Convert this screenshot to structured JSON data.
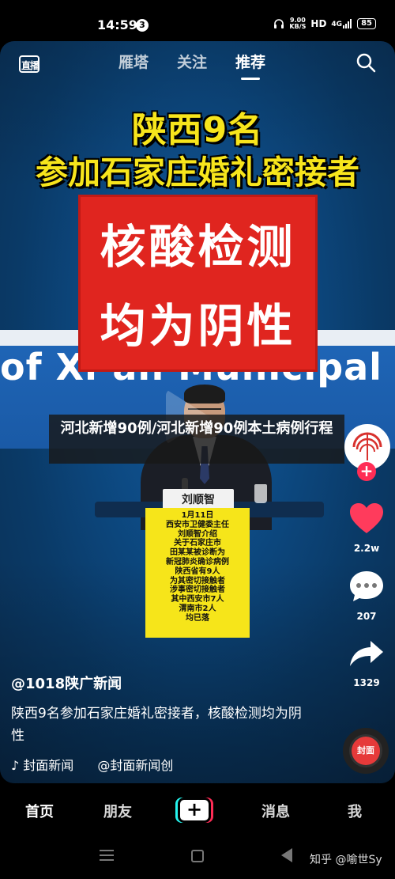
{
  "status": {
    "time": "14:59",
    "notification_count": "3",
    "speed_value": "9.00",
    "speed_unit": "KB/S",
    "hd": "HD",
    "signal": "4G",
    "battery": "85"
  },
  "nav": {
    "live_label": "直播",
    "tabs": [
      {
        "label": "雁塔"
      },
      {
        "label": "关注"
      },
      {
        "label": "推荐"
      }
    ],
    "active_tab": "推荐"
  },
  "video": {
    "headline_line1": "陕西9名",
    "headline_line2": "参加石家庄婚礼密接者",
    "red_line1": "核酸检测",
    "red_line2": "均为阴性",
    "backdrop_text": "of Xi’an Municipal P",
    "nameplate": "刘顺智",
    "info_card": [
      "1月11日",
      "西安市卫健委主任",
      "刘顺智介绍",
      "关于石家庄市",
      "田某某被诊断为",
      "新冠肺炎确诊病例",
      "陕西省有9人",
      "为其密切接触者",
      "涉事密切接触者",
      "其中西安市7人",
      "渭南市2人",
      "均已落"
    ]
  },
  "overlay_keyword": "河北新增90例/河北新增90例本土病例行程",
  "actions": {
    "like_count": "2.2w",
    "comment_count": "207",
    "share_count": "1329",
    "follow_plus": "+"
  },
  "post": {
    "author": "@1018陕广新闻",
    "caption": "陕西9名参加石家庄婚礼密接者，核酸检测均为阴性",
    "music_left": "♪ 封面新闻",
    "music_right": "@封面新闻创",
    "disc_label": "封面"
  },
  "tabbar": {
    "home": "首页",
    "friends": "朋友",
    "create": "+",
    "messages": "消息",
    "me": "我"
  },
  "watermark": "知乎 @喻世Sy",
  "colors": {
    "headline_yellow": "#f7e51c",
    "red_box": "#e0251f",
    "like_red": "#ff3b5c",
    "backdrop_blue": "#1f66b8"
  }
}
